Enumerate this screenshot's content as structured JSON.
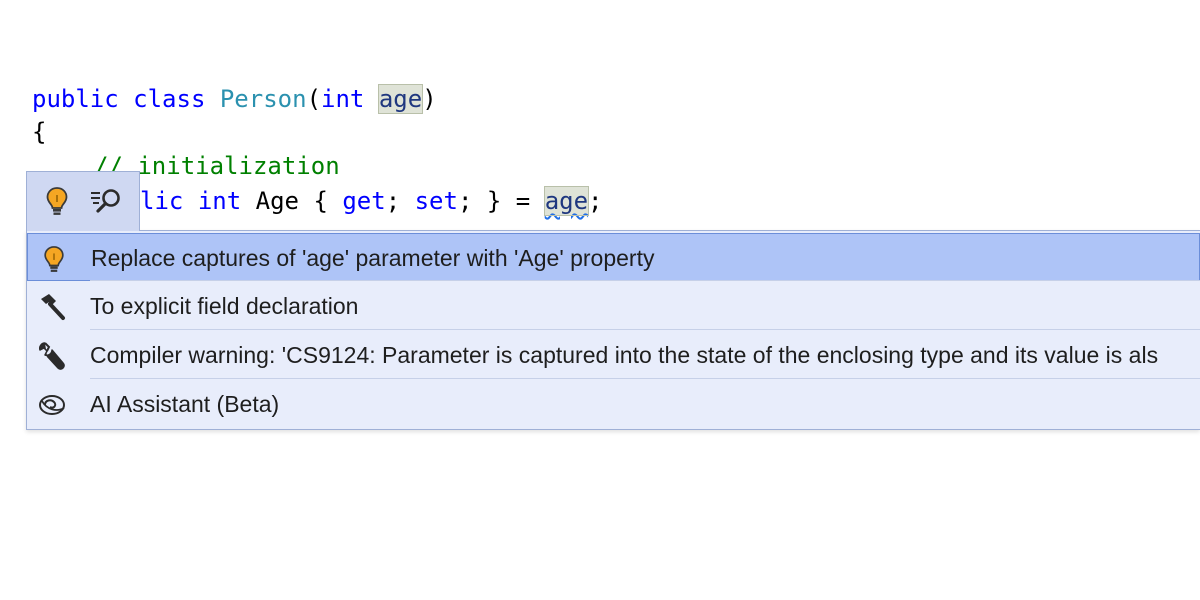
{
  "editor": {
    "line1": {
      "kw_public": "public",
      "kw_class": "class",
      "type_name": "Person",
      "open_paren": "(",
      "kw_int": "int",
      "param_name": "age",
      "close_paren": ")"
    },
    "line2": {
      "brace": "{"
    },
    "line3": {
      "comment": "// initialization"
    },
    "line4": {
      "kw_lic": "lic",
      "kw_int": "int",
      "prop_name": "Age",
      "open_brace": "{",
      "kw_get": "get",
      "semi1": ";",
      "kw_set": "set",
      "semi2": ";",
      "close_brace": "}",
      "equals": "=",
      "param_ref": "age",
      "semi3": ";"
    }
  },
  "colors": {
    "keyword": "#0000ff",
    "type": "#2b91af",
    "comment": "#008000",
    "param": "#1f377f",
    "popup_bg": "#e8edfb",
    "selected_bg": "#aec4f7"
  },
  "gutter_tab": {
    "icons": [
      "lightbulb-icon",
      "search-actions-icon"
    ]
  },
  "menu": {
    "items": [
      {
        "icon": "lightbulb-icon",
        "label": "Replace captures of 'age' parameter with 'Age' property",
        "selected": true
      },
      {
        "icon": "hammer-icon",
        "label": "To explicit field declaration",
        "selected": false
      },
      {
        "icon": "wrench-icon",
        "label": "Compiler warning: 'CS9124: Parameter is captured into the state of the enclosing type and its value is als",
        "selected": false
      },
      {
        "icon": "ai-assistant-icon",
        "label": "AI Assistant (Beta)",
        "selected": false
      }
    ]
  }
}
